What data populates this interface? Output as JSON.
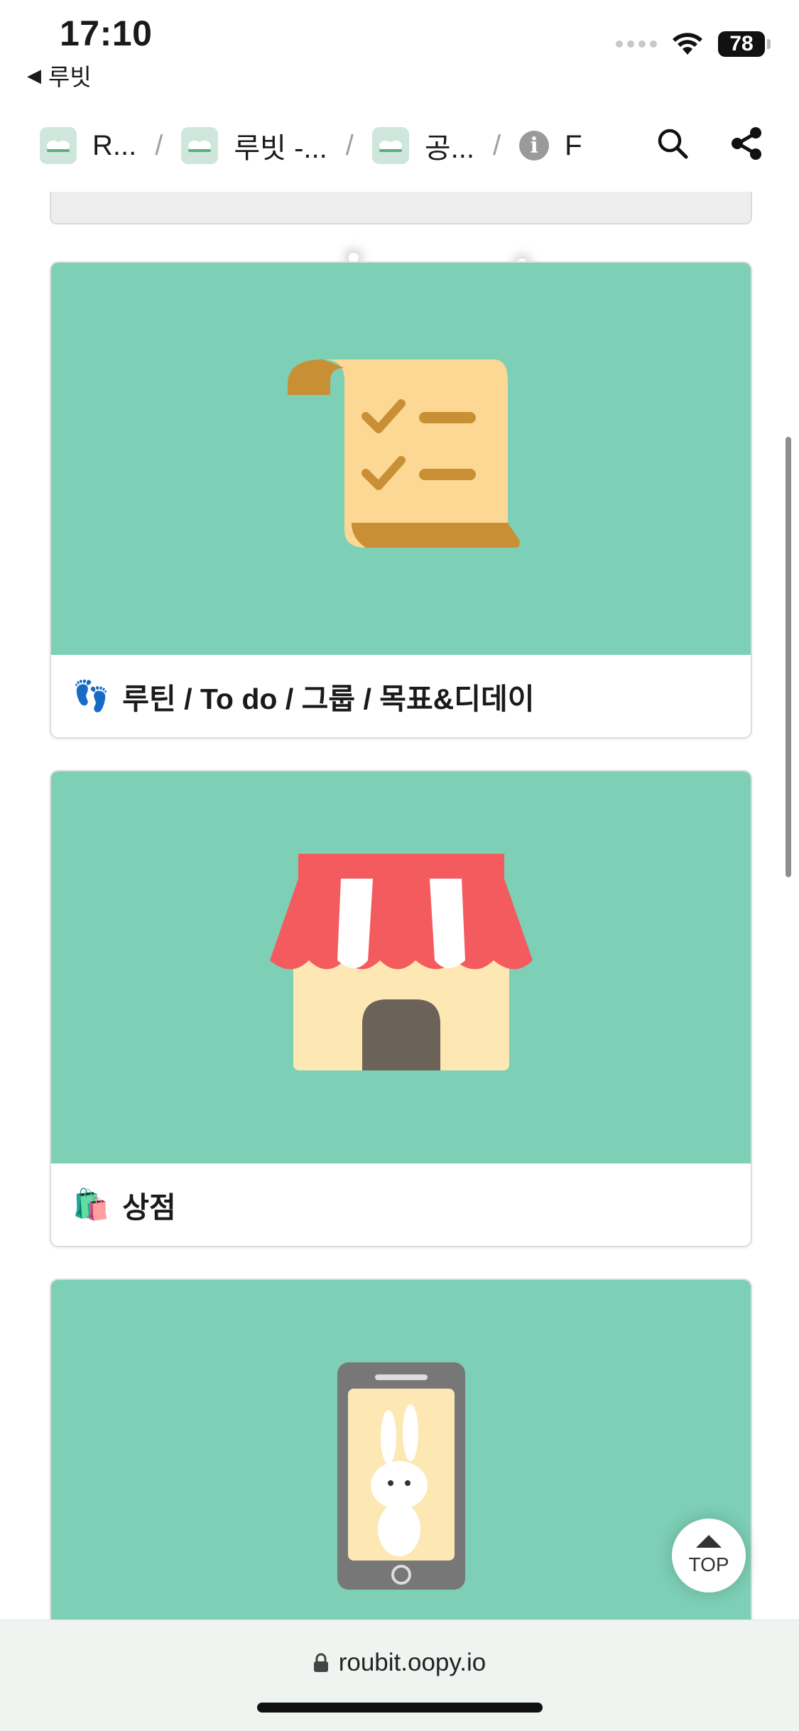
{
  "status": {
    "time": "17:10",
    "back_app": "루빗",
    "battery": "78"
  },
  "breadcrumb": [
    {
      "label": "R..."
    },
    {
      "label": "루빗 -..."
    },
    {
      "label": "공..."
    },
    {
      "label": "F"
    }
  ],
  "cards": [
    {
      "caption": "루틴 / To do / 그룹 / 목표&디데이",
      "emoji": "👣"
    },
    {
      "caption": "상점",
      "emoji": "🛍️"
    },
    {
      "caption": ""
    }
  ],
  "top_button": {
    "label": "TOP"
  },
  "url_bar": {
    "url": "roubit.oopy.io"
  },
  "colors": {
    "cover": "#7dcfb6",
    "awning_red": "#f45b5f",
    "paper": "#fcd894",
    "paper_dark": "#c98f35"
  }
}
